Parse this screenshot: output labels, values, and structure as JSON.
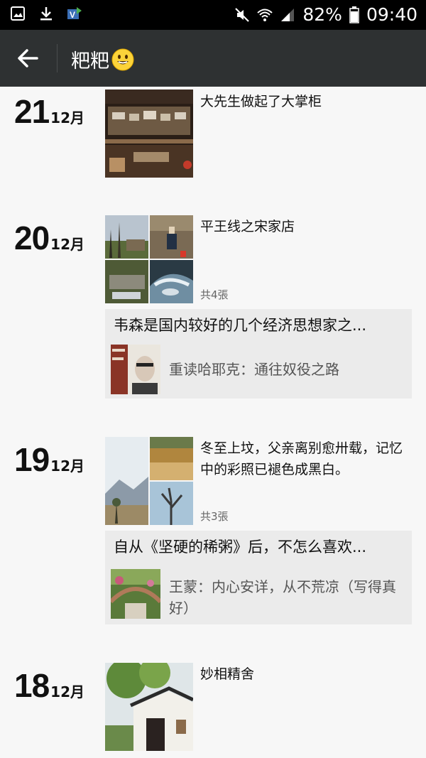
{
  "status_bar": {
    "battery": "82%",
    "time": "09:40",
    "icons": [
      "gallery-icon",
      "download-icon",
      "app-v-icon",
      "mute-icon",
      "wifi-icon",
      "signal-icon",
      "battery-icon"
    ]
  },
  "header": {
    "title": "粑粑",
    "emoji": "smiley-face-icon"
  },
  "posts": [
    {
      "day": "21",
      "month": "12月",
      "text": "大先生做起了大掌柜"
    },
    {
      "day": "20",
      "month": "12月",
      "text": "平王线之宋家店",
      "count": "共4張",
      "share": {
        "title": "韦森是国内较好的几个经济思想家之...",
        "text": "重读哈耶克：通往奴役之路"
      }
    },
    {
      "day": "19",
      "month": "12月",
      "text": "冬至上坟，父亲离别愈卅载，记忆中的彩照已褪色成黑白。",
      "count": "共3張",
      "share": {
        "title": "自从《坚硬的稀粥》后，不怎么喜欢...",
        "text": "王蒙：内心安详，从不荒凉（写得真好）"
      }
    },
    {
      "day": "18",
      "month": "12月",
      "text": "妙相精舍"
    }
  ]
}
